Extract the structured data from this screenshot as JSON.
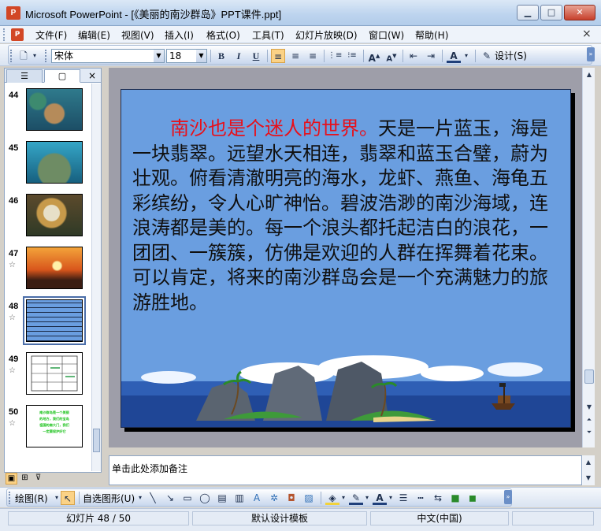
{
  "window": {
    "title": "Microsoft PowerPoint - [《美丽的南沙群岛》PPT课件.ppt]",
    "min_icon": "minimize-icon",
    "max_icon": "maximize-icon",
    "close_icon": "close-icon"
  },
  "menu": {
    "items": [
      "文件(F)",
      "编辑(E)",
      "视图(V)",
      "插入(I)",
      "格式(O)",
      "工具(T)",
      "幻灯片放映(D)",
      "窗口(W)",
      "帮助(H)"
    ],
    "close_glyph": "×"
  },
  "format_toolbar": {
    "font_name": "宋体",
    "font_size": "18",
    "bold": "B",
    "italic": "I",
    "underline": "U",
    "font_color_glyph": "A",
    "design_label": "设计(S)"
  },
  "slide_panel": {
    "tabs": [
      "outline-tab",
      "slides-tab"
    ],
    "close_glyph": "×",
    "thumbnails": [
      {
        "number": "44",
        "has_animation": false
      },
      {
        "number": "45",
        "has_animation": false
      },
      {
        "number": "46",
        "has_animation": false
      },
      {
        "number": "47",
        "has_animation": true
      },
      {
        "number": "48",
        "has_animation": true,
        "selected": true
      },
      {
        "number": "49",
        "has_animation": true
      },
      {
        "number": "50",
        "has_animation": true
      }
    ],
    "star_glyph": "☆",
    "slide50_lines": [
      "南沙群岛是一个美丽",
      "的地方，我们的宝岛",
      "祖国的南大门，我们",
      "一定要保护好它"
    ]
  },
  "slide": {
    "highlight": "南沙也是个迷人的世界。",
    "body": "天是一片蓝玉，海是一块翡翠。远望水天相连，翡翠和蓝玉合璧，蔚为壮观。俯看清澈明亮的海水，龙虾、燕鱼、海龟五彩缤纷，令人心旷神怡。碧波浩渺的南沙海域，连浪涛都是美的。每一个浪头都托起洁白的浪花，一团团、一簇簇，仿佛是欢迎的人群在挥舞着花束。可以肯定，将来的南沙群岛会是一个充满魅力的旅游胜地。",
    "colors": {
      "background": "#6a9ee0",
      "highlight": "#e8101a",
      "text": "#101010"
    }
  },
  "notes": {
    "placeholder": "单击此处添加备注"
  },
  "drawing_toolbar": {
    "draw_label": "绘图(R)",
    "autoshapes_label": "自选图形(U)",
    "font_color_glyph": "A"
  },
  "status": {
    "slide_position": "幻灯片 48 / 50",
    "design_template": "默认设计模板",
    "language": "中文(中国)"
  }
}
